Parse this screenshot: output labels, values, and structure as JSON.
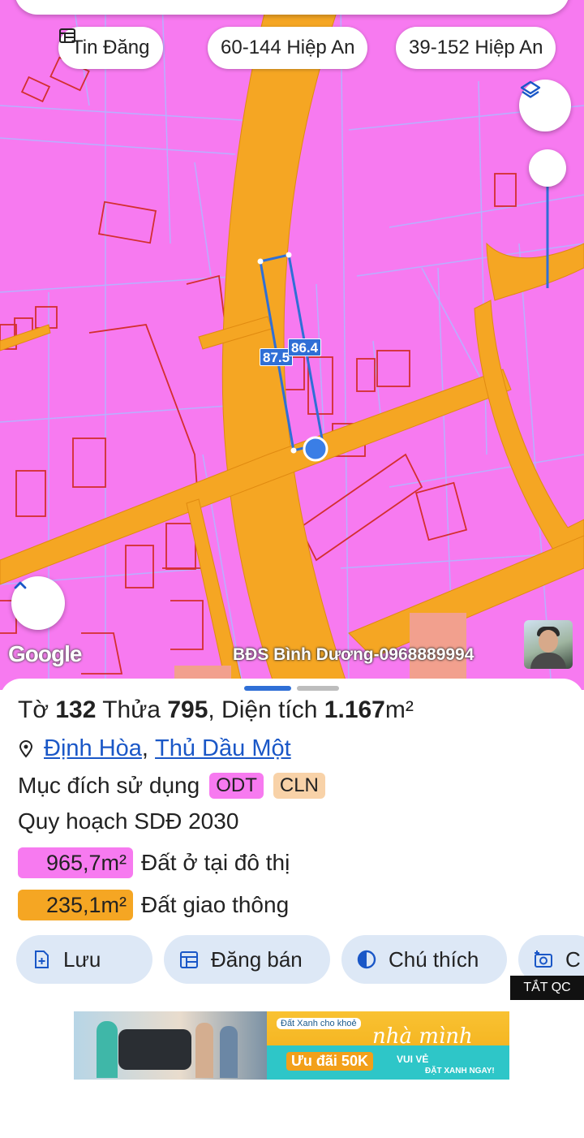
{
  "map": {
    "chips": [
      {
        "label": "Tin Đăng",
        "icon": "list-icon"
      },
      {
        "label": "60-144 Hiệp An"
      },
      {
        "label": "39-152 Hiệp An"
      }
    ],
    "measure_labels": [
      "87.5",
      "86.4"
    ],
    "attribution": "Google",
    "watermark": "BĐS Bình Dương-0968889994",
    "colors": {
      "land": "#f77af0",
      "road": "#f5a623",
      "parcel_line": "#b0b6ff",
      "boundary": "#d32f2f",
      "measure": "#2f6fd6"
    }
  },
  "parcel": {
    "to_label": "Tờ",
    "to_value": "132",
    "thua_label": "Thửa",
    "thua_value": "795",
    "area_label": ", Diện tích",
    "area_value": "1.167",
    "area_unit": "m²",
    "ward": "Định Hòa",
    "district": "Thủ Dầu Một",
    "purpose_label": "Mục đích sử dụng",
    "purpose_tags": [
      {
        "code": "ODT",
        "color": "#f77af0"
      },
      {
        "code": "CLN",
        "color": "#f8d2a8"
      }
    ],
    "plan_label": "Quy hoạch SDĐ 2030",
    "plan_areas": [
      {
        "value": "965,7m²",
        "label": "Đất ở tại đô thị",
        "color": "#f77af0"
      },
      {
        "value": "235,1m²",
        "label": "Đất giao thông",
        "color": "#f5a623"
      }
    ]
  },
  "actions": [
    {
      "label": "Lưu",
      "icon": "add-file-icon"
    },
    {
      "label": "Đăng bán",
      "icon": "calendar-icon"
    },
    {
      "label": "Chú thích",
      "icon": "contrast-icon"
    },
    {
      "label": "C",
      "icon": "camera-add-icon"
    }
  ],
  "ad": {
    "close_label": "TẮT QC",
    "tag": "Đất Xanh cho khoẻ",
    "headline": "nhà mình",
    "promo": "Ưu đãi 50K",
    "tagline": "VUI VẺ",
    "cta": "ĐẶT XANH NGAY!"
  }
}
